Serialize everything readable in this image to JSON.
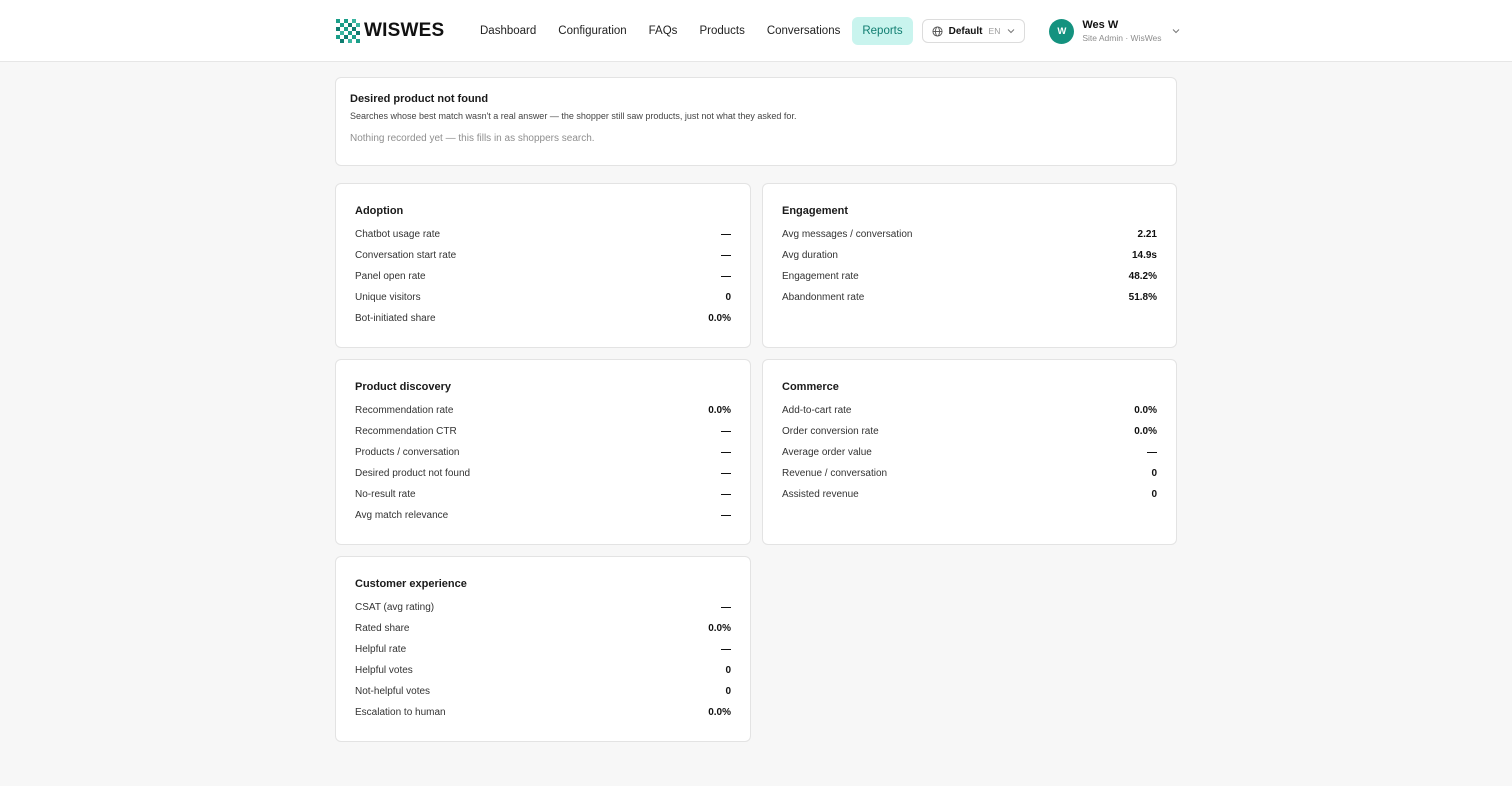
{
  "brand": {
    "name": "WISWES"
  },
  "nav": {
    "items": [
      {
        "label": "Dashboard",
        "active": false
      },
      {
        "label": "Configuration",
        "active": false
      },
      {
        "label": "FAQs",
        "active": false
      },
      {
        "label": "Products",
        "active": false
      },
      {
        "label": "Conversations",
        "active": false
      },
      {
        "label": "Reports",
        "active": true
      }
    ]
  },
  "environment": {
    "label": "Default",
    "lang": "EN"
  },
  "user": {
    "initial": "W",
    "name": "Wes W",
    "role": "Site Admin · WisWes"
  },
  "alert": {
    "title": "Desired product not found",
    "description": "Searches whose best match wasn't a real answer — the shopper still saw products, just not what they asked for.",
    "empty": "Nothing recorded yet — this fills in as shoppers search."
  },
  "cards": {
    "adoption": {
      "title": "Adoption",
      "rows": [
        {
          "label": "Chatbot usage rate",
          "value": "—"
        },
        {
          "label": "Conversation start rate",
          "value": "—"
        },
        {
          "label": "Panel open rate",
          "value": "—"
        },
        {
          "label": "Unique visitors",
          "value": "0"
        },
        {
          "label": "Bot-initiated share",
          "value": "0.0%"
        }
      ]
    },
    "engagement": {
      "title": "Engagement",
      "rows": [
        {
          "label": "Avg messages / conversation",
          "value": "2.21"
        },
        {
          "label": "Avg duration",
          "value": "14.9s"
        },
        {
          "label": "Engagement rate",
          "value": "48.2%"
        },
        {
          "label": "Abandonment rate",
          "value": "51.8%"
        }
      ]
    },
    "product_discovery": {
      "title": "Product discovery",
      "rows": [
        {
          "label": "Recommendation rate",
          "value": "0.0%"
        },
        {
          "label": "Recommendation CTR",
          "value": "—"
        },
        {
          "label": "Products / conversation",
          "value": "—"
        },
        {
          "label": "Desired product not found",
          "value": "—"
        },
        {
          "label": "No-result rate",
          "value": "—"
        },
        {
          "label": "Avg match relevance",
          "value": "—"
        }
      ]
    },
    "commerce": {
      "title": "Commerce",
      "rows": [
        {
          "label": "Add-to-cart rate",
          "value": "0.0%"
        },
        {
          "label": "Order conversion rate",
          "value": "0.0%"
        },
        {
          "label": "Average order value",
          "value": "—"
        },
        {
          "label": "Revenue / conversation",
          "value": "0"
        },
        {
          "label": "Assisted revenue",
          "value": "0"
        }
      ]
    },
    "customer_experience": {
      "title": "Customer experience",
      "rows": [
        {
          "label": "CSAT (avg rating)",
          "value": "—"
        },
        {
          "label": "Rated share",
          "value": "0.0%"
        },
        {
          "label": "Helpful rate",
          "value": "—"
        },
        {
          "label": "Helpful votes",
          "value": "0"
        },
        {
          "label": "Not-helpful votes",
          "value": "0"
        },
        {
          "label": "Escalation to human",
          "value": "0.0%"
        }
      ]
    }
  },
  "colors": {
    "accent": "#14927f",
    "active_nav_bg": "#c9f4ee",
    "active_nav_text": "#0f7d70"
  },
  "icons": {
    "logo": "checker-logo-icon",
    "globe": "globe-icon",
    "chevron": "chevron-down-icon"
  }
}
